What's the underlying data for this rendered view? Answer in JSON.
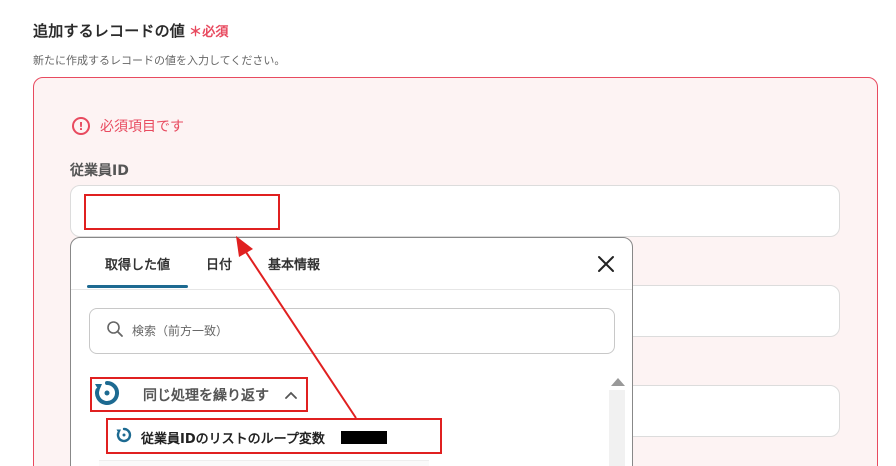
{
  "section": {
    "title": "追加するレコードの値",
    "required_mark": "＊必須",
    "description": "新たに作成するレコードの値を入力してください。"
  },
  "form": {
    "error_message": "必須項目です",
    "field_label": "従業員ID",
    "field_value": ""
  },
  "popup": {
    "tabs": [
      {
        "label": "取得した値",
        "active": true
      },
      {
        "label": "日付",
        "active": false
      },
      {
        "label": "基本情報",
        "active": false
      }
    ],
    "search_placeholder": "検索（前方一致）",
    "group_label": "同じ処理を繰り返す",
    "loop_item_label": "従業員IDのリストのループ変数"
  },
  "colors": {
    "error": "#e84a5f",
    "highlight": "#e02020",
    "accent": "#1d6a91"
  },
  "icons": {
    "error": "exclamation-circle-icon",
    "close": "close-icon",
    "search": "search-icon",
    "loop": "loop-icon",
    "chevron": "chevron-up-icon"
  }
}
